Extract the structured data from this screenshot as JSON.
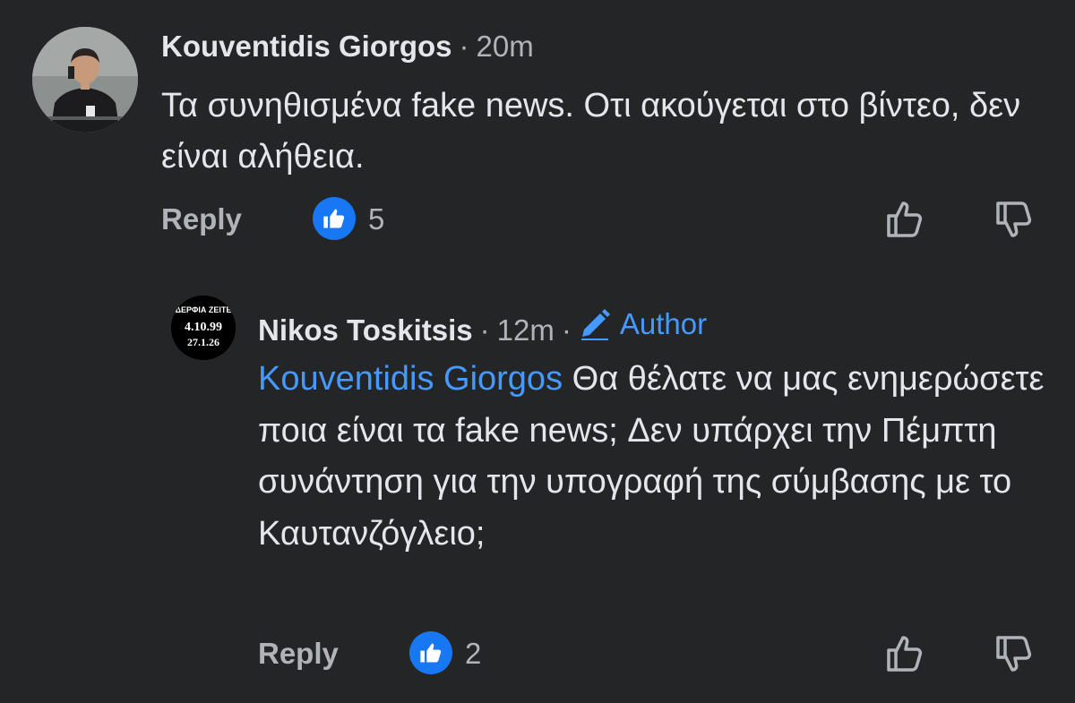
{
  "comments": [
    {
      "author": "Kouventidis Giorgos",
      "time": "20m",
      "text": "Τα συνηθισμένα fake news. Οτι ακούγεται στο βίντεο, δεν είναι αλήθεια.",
      "reply_label": "Reply",
      "like_count": "5"
    },
    {
      "author": "Nikos Toskitsis",
      "time": "12m",
      "badge": "Author",
      "mention": "Kouventidis Giorgos",
      "text": "Θα θέλατε να μας ενημερώσετε ποια είναι τα fake news; Δεν υπάρχει την Πέμπτη συνάντηση για την υπογραφή της σύμβασης με το Καυτανζόγλειο;",
      "reply_label": "Reply",
      "like_count": "2",
      "avatar_text": {
        "line1": "ΔΕΡΦΙΑ ΖΕΙΤΕ",
        "line2": "4.10.99",
        "line3": "27.1.26"
      }
    }
  ],
  "separator": "·",
  "colors": {
    "background": "#242526",
    "primary_text": "#e4e6eb",
    "secondary_text": "#b0b3b8",
    "link_blue": "#4599ff",
    "like_blue": "#1877f2"
  },
  "icons": [
    "thumbs-up-reaction-icon",
    "upvote-icon",
    "downvote-icon",
    "pencil-icon"
  ]
}
